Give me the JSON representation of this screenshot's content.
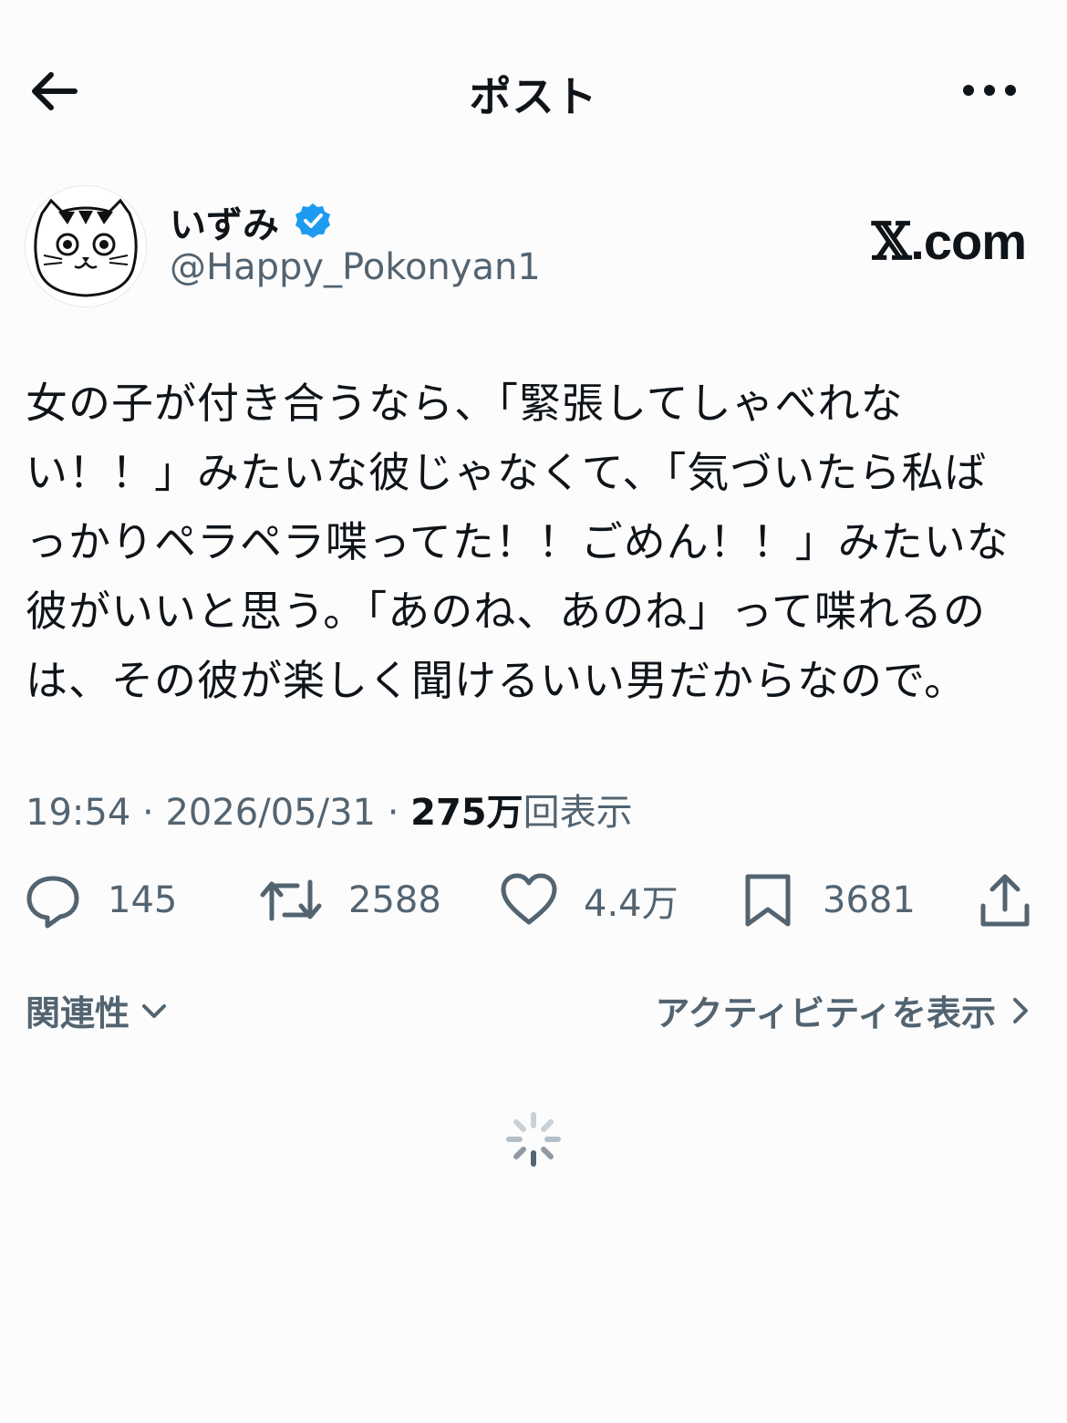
{
  "header": {
    "title": "ポスト",
    "back_icon": "back-arrow-icon",
    "more_icon": "more-horizontal-icon"
  },
  "author": {
    "display_name": "いずみ",
    "handle": "@Happy_Pokonyan1",
    "verified": true,
    "verified_color": "#1d9bf0"
  },
  "watermark": {
    "x_mark": "𝕏",
    "domain": ".com"
  },
  "post": {
    "text": "女の子が付き合うなら、「緊張してしゃべれな\nい！！」みたいな彼じゃなくて、「気づいたら私ば\nっかりペラペラ喋ってた！！ごめん！！」みたいな\n彼がいいと思う。「あのね、あのね」って喋れるの\nは、その彼が楽しく聞けるいい男だからなので。",
    "time": "19:54",
    "date": "2026/05/31",
    "separator": " · ",
    "views_count": "275万",
    "views_label": "回表示"
  },
  "actions": {
    "replies": "145",
    "retweets": "2588",
    "likes": "4.4万",
    "bookmarks": "3681"
  },
  "sort": {
    "relevance_label": "関連性",
    "activity_label": "アクティビティを表示"
  },
  "colors": {
    "text_primary": "#0f1419",
    "text_secondary": "#536471",
    "background": "#fcfcfd"
  }
}
